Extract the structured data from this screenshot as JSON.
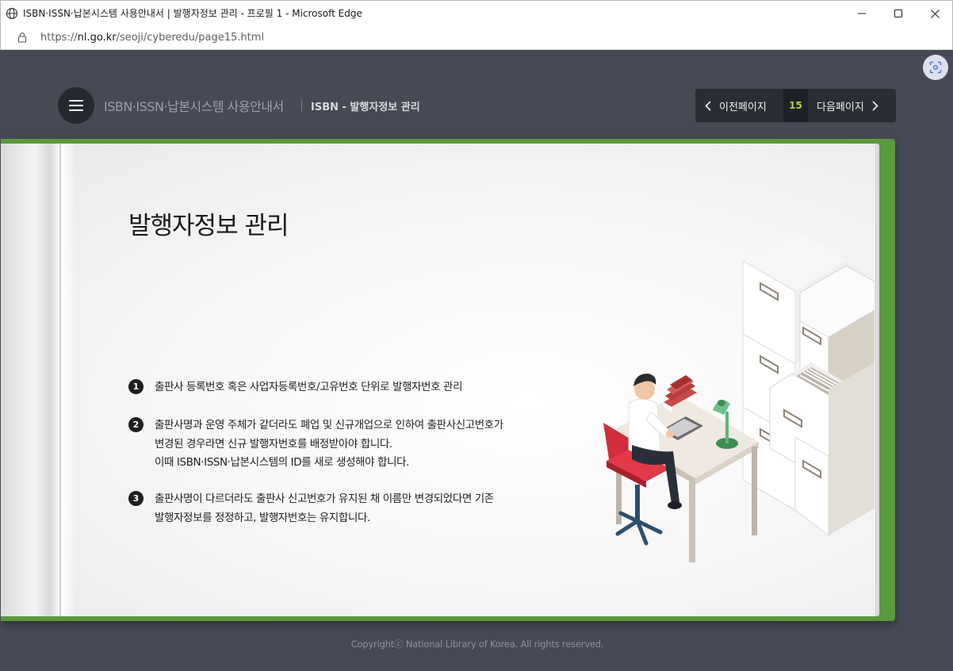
{
  "window": {
    "title": "ISBN·ISSN·납본시스템 사용안내서 | 발행자정보 관리 - 프로필 1 - Microsoft Edge"
  },
  "address": {
    "url_prefix": "https://",
    "url_host": "nl.go.kr",
    "url_path": "/seoji/cyberedu/page15.html"
  },
  "header": {
    "site_title": "ISBN·ISSN·납본시스템 사용안내서",
    "section_title": "ISBN - 발행자정보 관리"
  },
  "pager": {
    "prev_label": "이전페이지",
    "page_number": "15",
    "next_label": "다음페이지"
  },
  "content": {
    "heading": "발행자정보 관리",
    "items": [
      {
        "num": "1",
        "lines": [
          "출판사 등록번호 혹은 사업자등록번호/고유번호 단위로 발행자번호 관리"
        ]
      },
      {
        "num": "2",
        "lines": [
          "출판사명과 운영 주체가 같더라도 폐업 및 신규개업으로 인하여 출판사신고번호가",
          "변경된 경우라면 신규 발행자번호를 배정받아야 합니다.",
          "이때 ISBN·ISSN·납본시스템의 ID를 새로 생성해야 합니다."
        ]
      },
      {
        "num": "3",
        "lines": [
          "출판사명이 다르더라도 출판사 신고번호가 유지된 채 이름만 변경되었다면 기존",
          "발행자정보를 정정하고, 발행자번호는 유지합니다."
        ]
      }
    ]
  },
  "footer": {
    "copyright": "Copyrightⓒ National Library of Korea. All rights reserved."
  },
  "colors": {
    "page_bg": "#474955",
    "book_cover": "#5b9a3e",
    "page_number_accent": "#b8d14b"
  }
}
